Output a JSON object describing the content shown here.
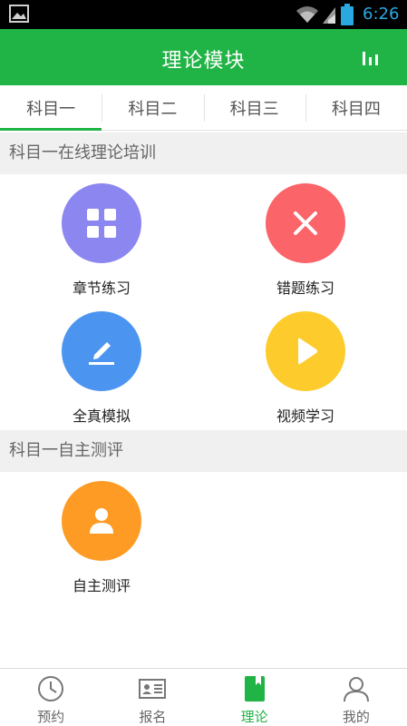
{
  "status_bar": {
    "time": "6:26"
  },
  "header": {
    "title": "理论模块",
    "action_icon": "bar-chart-icon"
  },
  "tabs": [
    {
      "label": "科目一",
      "active": true
    },
    {
      "label": "科目二",
      "active": false
    },
    {
      "label": "科目三",
      "active": false
    },
    {
      "label": "科目四",
      "active": false
    }
  ],
  "sections": {
    "training": {
      "title": "科目一在线理论培训",
      "items": [
        {
          "label": "章节练习",
          "icon": "grid-icon",
          "color": "#8c86f0"
        },
        {
          "label": "错题练习",
          "icon": "close-icon",
          "color": "#fb6468"
        },
        {
          "label": "全真模拟",
          "icon": "pencil-icon",
          "color": "#4b95f0"
        },
        {
          "label": "视频学习",
          "icon": "play-icon",
          "color": "#fdcc2c"
        }
      ]
    },
    "assessment": {
      "title": "科目一自主测评",
      "items": [
        {
          "label": "自主测评",
          "icon": "person-icon",
          "color": "#fd9b24"
        }
      ]
    }
  },
  "bottom_nav": [
    {
      "label": "预约",
      "icon": "clock-icon",
      "active": false
    },
    {
      "label": "报名",
      "icon": "id-card-icon",
      "active": false
    },
    {
      "label": "理论",
      "icon": "book-icon",
      "active": true
    },
    {
      "label": "我的",
      "icon": "user-icon",
      "active": false
    }
  ],
  "colors": {
    "accent": "#20b345",
    "status_icon": "#29a9e0"
  }
}
